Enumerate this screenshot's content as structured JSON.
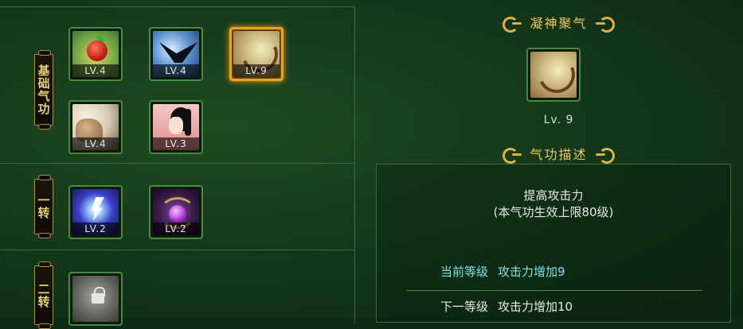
{
  "left": {
    "sections": [
      {
        "label": "基础气功",
        "skills": [
          {
            "icon": "fruit-icon",
            "level": "LV.4",
            "selected": false
          },
          {
            "icon": "bird-wing-icon",
            "level": "LV.4",
            "selected": false
          },
          {
            "icon": "bow-icon",
            "level": "LV.9",
            "selected": true
          },
          {
            "icon": "fist-icon",
            "level": "LV.4",
            "selected": false
          },
          {
            "icon": "warrior-portrait-icon",
            "level": "LV.3",
            "selected": false
          }
        ]
      },
      {
        "label": "一转",
        "skills": [
          {
            "icon": "lightning-icon",
            "level": "LV.2",
            "selected": false
          },
          {
            "icon": "purple-orb-icon",
            "level": "LV.2",
            "selected": false
          }
        ]
      },
      {
        "label": "二转",
        "skills": [
          {
            "icon": "locked-skill-icon",
            "level": "",
            "selected": false
          }
        ]
      }
    ]
  },
  "right": {
    "skill_title": "凝神聚气",
    "skill_level": "Lv. 9",
    "desc_title": "气功描述",
    "desc_main": "提高攻击力",
    "desc_sub": "(本气功生效上限80级)",
    "current_label": "当前等级",
    "current_value": "攻击力增加9",
    "next_label": "下一等级",
    "next_value": "攻击力增加10"
  },
  "colors": {
    "accent_gold": "#f0c560",
    "selected_border": "#f0a01a",
    "current_text": "#7fe0e6"
  }
}
